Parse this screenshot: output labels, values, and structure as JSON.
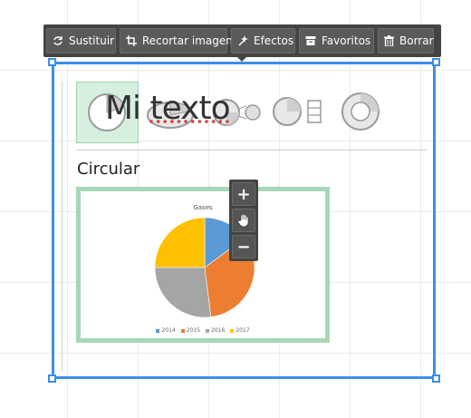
{
  "toolbar": {
    "buttons": [
      {
        "label": "Sustituir",
        "icon": "refresh-icon"
      },
      {
        "label": "Recortar imagen",
        "icon": "crop-icon"
      },
      {
        "label": "Efectos",
        "icon": "sparkle-icon"
      },
      {
        "label": "Favoritos",
        "icon": "archive-icon"
      },
      {
        "label": "Borrar",
        "icon": "trash-icon"
      }
    ]
  },
  "editor": {
    "overlay_text_before": "Mi ",
    "overlay_text_underlined": "texto",
    "section_label": "Circular",
    "chart_types": [
      "pie-chart-icon",
      "pie-exploded-icon",
      "pie-of-pie-icon",
      "bar-of-pie-icon",
      "doughnut-icon"
    ]
  },
  "zoom": {
    "zoom_in": "+",
    "zoom_out": "−",
    "pan_icon": "hand-icon"
  },
  "colors": {
    "selection": "#3d8ee8",
    "selected_type_bg": "#d7efdf",
    "card_border": "#a6d7b7"
  },
  "chart_data": {
    "type": "pie",
    "title": "Gases",
    "categories": [
      "2014",
      "2015",
      "2016",
      "2017"
    ],
    "values": [
      15,
      33,
      27,
      25
    ],
    "colors": [
      "#5b9bd5",
      "#ed7d31",
      "#a5a5a5",
      "#ffc000"
    ],
    "legend": "bottom"
  }
}
